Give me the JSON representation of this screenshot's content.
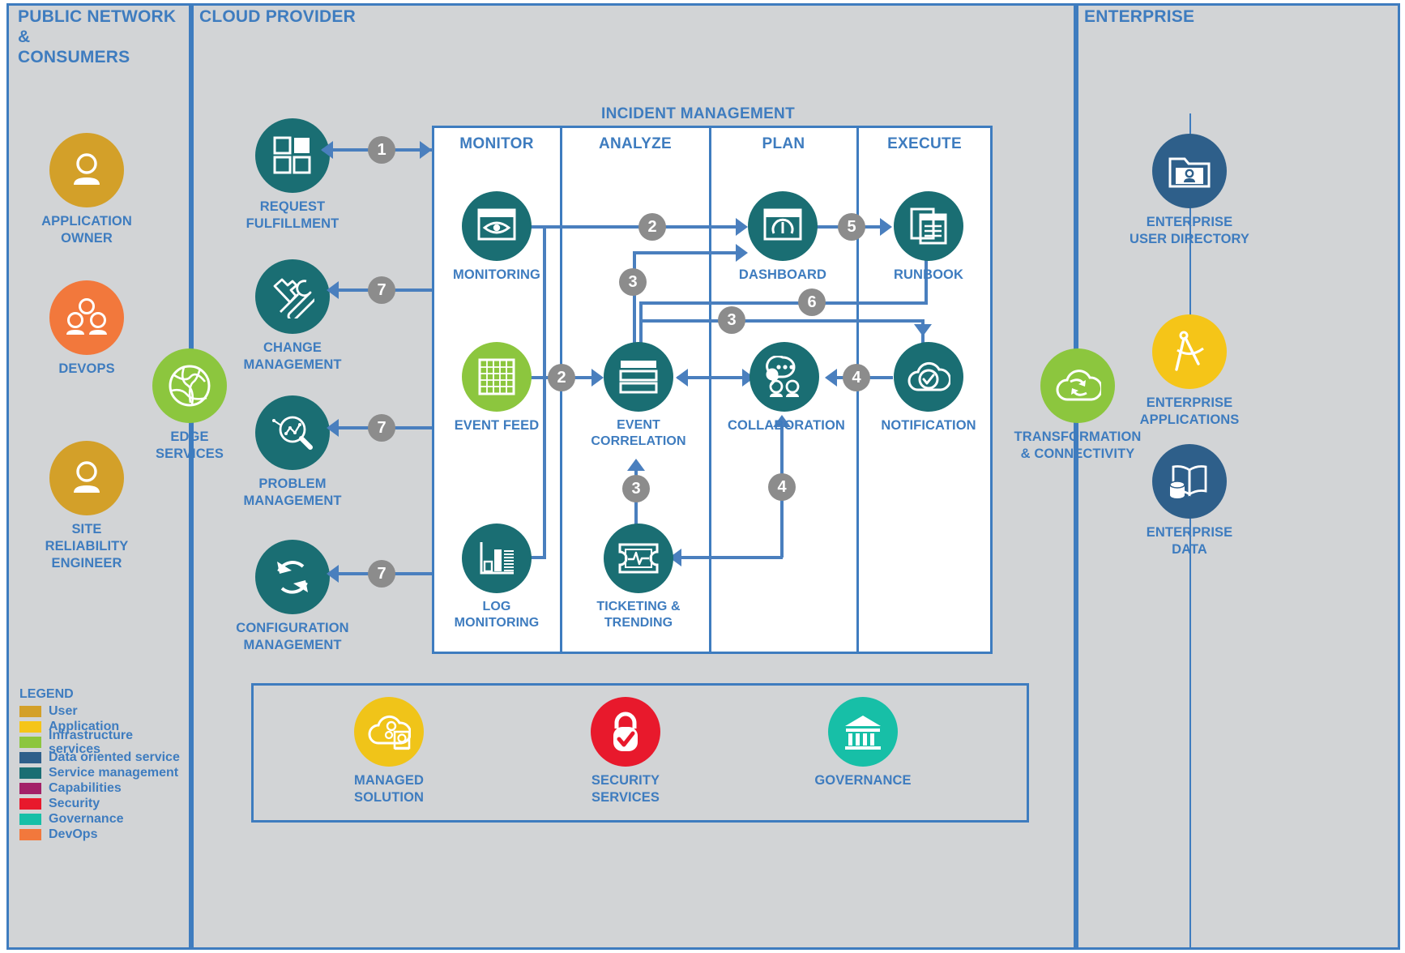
{
  "zones": {
    "public": {
      "title": "PUBLIC NETWORK &\nCONSUMERS"
    },
    "cloud": {
      "title": "CLOUD PROVIDER"
    },
    "enterprise": {
      "title": "ENTERPRISE"
    }
  },
  "colors": {
    "user": "#d3a029",
    "application": "#f5c518",
    "infrastructure": "#8cc63e",
    "data_oriented": "#2e5f8a",
    "service_management": "#1a6e73",
    "capabilities": "#a32168",
    "security": "#e8192c",
    "governance": "#17bfa7",
    "devops": "#f2783c",
    "accent_blue": "#3e7cbf",
    "connector_blue": "#4a7fbe",
    "badge_gray": "#8c8c8c",
    "zone_bg": "#d2d4d6"
  },
  "consumers": [
    {
      "label": "APPLICATION\nOWNER",
      "icon": "single-user-icon",
      "color": "#d3a029"
    },
    {
      "label": "DEVOPS",
      "icon": "user-group-icon",
      "color": "#f2783c"
    },
    {
      "label": "SITE RELIABILITY\nENGINEER",
      "icon": "single-user-icon",
      "color": "#d3a029"
    }
  ],
  "edge": {
    "label": "EDGE\nSERVICES",
    "icon": "globe-network-icon",
    "color": "#8cc63e"
  },
  "service_management": [
    {
      "label": "REQUEST\nFULFILLMENT",
      "icon": "tiles-icon",
      "color": "#1a6e73",
      "badge": "1"
    },
    {
      "label": "CHANGE\nMANAGEMENT",
      "icon": "hammer-wrench-icon",
      "color": "#1a6e73",
      "badge": "7"
    },
    {
      "label": "PROBLEM\nMANAGEMENT",
      "icon": "magnifier-chart-icon",
      "color": "#1a6e73",
      "badge": "7"
    },
    {
      "label": "CONFIGURATION\nMANAGEMENT",
      "icon": "refresh-cycle-icon",
      "color": "#1a6e73",
      "badge": "7"
    }
  ],
  "incident_management": {
    "title": "INCIDENT MANAGEMENT",
    "columns": [
      "MONITOR",
      "ANALYZE",
      "PLAN",
      "EXECUTE"
    ],
    "nodes": [
      {
        "label": "MONITORING",
        "icon": "eye-monitor-icon",
        "color": "#1a6e73",
        "column": "MONITOR"
      },
      {
        "label": "EVENT FEED",
        "icon": "grid-table-icon",
        "color": "#8cc63e",
        "column": "MONITOR"
      },
      {
        "label": "LOG\nMONITORING",
        "icon": "bar-chart-icon",
        "color": "#1a6e73",
        "column": "MONITOR"
      },
      {
        "label": "EVENT\nCORRELATION",
        "icon": "stacked-rows-icon",
        "color": "#1a6e73",
        "column": "ANALYZE"
      },
      {
        "label": "TICKETING &\nTRENDING",
        "icon": "ticket-pulse-icon",
        "color": "#1a6e73",
        "column": "ANALYZE"
      },
      {
        "label": "DASHBOARD",
        "icon": "gauge-power-icon",
        "color": "#1a6e73",
        "column": "PLAN"
      },
      {
        "label": "COLLABORATION",
        "icon": "chat-people-icon",
        "color": "#1a6e73",
        "column": "PLAN"
      },
      {
        "label": "RUNBOOK",
        "icon": "documents-icon",
        "color": "#1a6e73",
        "column": "EXECUTE"
      },
      {
        "label": "NOTIFICATION",
        "icon": "cloud-check-icon",
        "color": "#1a6e73",
        "column": "EXECUTE"
      }
    ],
    "flow_badges": [
      "1",
      "2",
      "2",
      "3",
      "3",
      "3",
      "4",
      "4",
      "5",
      "6",
      "7",
      "7",
      "7"
    ]
  },
  "flow_labels": {
    "b1": "1",
    "b2a": "2",
    "b2b": "2",
    "b3a": "3",
    "b3b": "3",
    "b3c": "3",
    "b4a": "4",
    "b4b": "4",
    "b5": "5",
    "b6": "6",
    "b7a": "7",
    "b7b": "7",
    "b7c": "7"
  },
  "transformation": {
    "label": "TRANSFORMATION\n& CONNECTIVITY",
    "icon": "cloud-sync-icon",
    "color": "#8cc63e"
  },
  "enterprise_items": [
    {
      "label": "ENTERPRISE\nUSER DIRECTORY",
      "icon": "user-folder-icon",
      "color": "#2e5f8a"
    },
    {
      "label": "ENTERPRISE\nAPPLICATIONS",
      "icon": "compass-icon",
      "color": "#f5c518"
    },
    {
      "label": "ENTERPRISE\nDATA",
      "icon": "book-database-icon",
      "color": "#2e5f8a"
    }
  ],
  "bottom_services": [
    {
      "label": "MANAGED\nSOLUTION",
      "icon": "cloud-gears-icon",
      "color": "#f0c419"
    },
    {
      "label": "SECURITY\nSERVICES",
      "icon": "lock-check-icon",
      "color": "#e8192c"
    },
    {
      "label": "GOVERNANCE",
      "icon": "bank-columns-icon",
      "color": "#17bfa7"
    }
  ],
  "legend": {
    "title": "LEGEND",
    "items": [
      {
        "label": "User",
        "color": "#d3a029"
      },
      {
        "label": "Application",
        "color": "#f5c518"
      },
      {
        "label": "Infrastructure services",
        "color": "#8cc63e"
      },
      {
        "label": "Data oriented service",
        "color": "#2e5f8a"
      },
      {
        "label": "Service management",
        "color": "#1a6e73"
      },
      {
        "label": "Capabilities",
        "color": "#a32168"
      },
      {
        "label": "Security",
        "color": "#e8192c"
      },
      {
        "label": "Governance",
        "color": "#17bfa7"
      },
      {
        "label": "DevOps",
        "color": "#f2783c"
      }
    ]
  }
}
